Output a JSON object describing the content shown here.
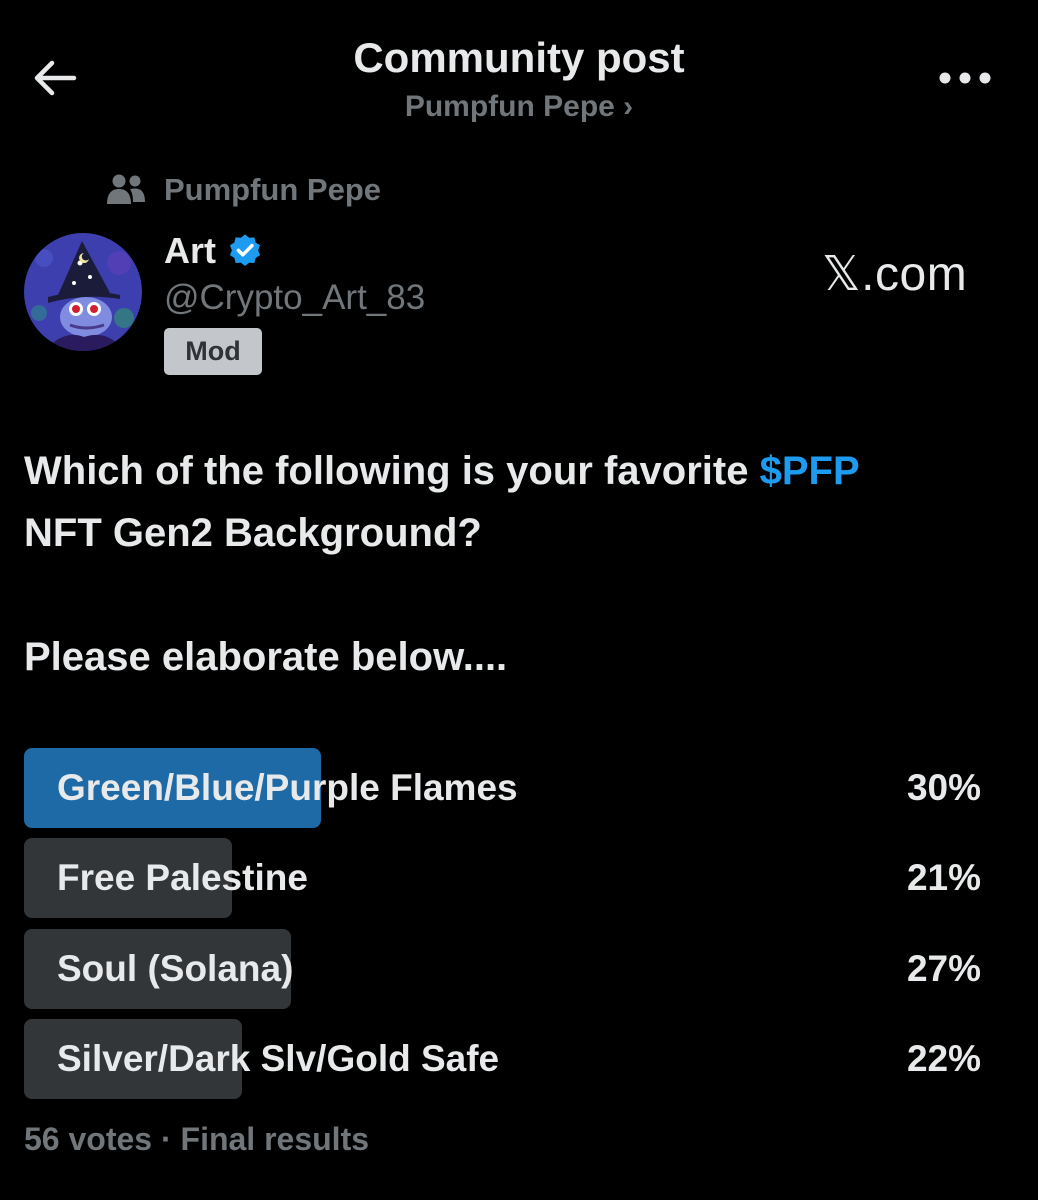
{
  "header": {
    "title": "Community post",
    "subtitle": "Pumpfun Pepe ›",
    "back_icon": "arrow-left-icon",
    "more_icon": "more-horizontal-icon"
  },
  "community": {
    "icon": "people-icon",
    "name": "Pumpfun Pepe"
  },
  "author": {
    "name": "Art",
    "verified_icon": "verified-badge-icon",
    "handle": "@Crypto_Art_83",
    "badge": "Mod"
  },
  "watermark": "𝕏.com",
  "post": {
    "line1_text": "Which of the following is your favorite ",
    "cashtag": "$PFP",
    "line2_text": "NFT Gen2 Background?",
    "line3_text": "Please elaborate below...."
  },
  "poll": {
    "options": [
      {
        "label": "Green/Blue/Purple Flames",
        "percent_text": "30%",
        "percent": 30,
        "winner": true
      },
      {
        "label": "Free Palestine",
        "percent_text": "21%",
        "percent": 21,
        "winner": false
      },
      {
        "label": "Soul (Solana)",
        "percent_text": "27%",
        "percent": 27,
        "winner": false
      },
      {
        "label": "Silver/Dark Slv/Gold Safe",
        "percent_text": "22%",
        "percent": 22,
        "winner": false
      }
    ],
    "footer": "56 votes · Final results"
  },
  "colors": {
    "background": "#000000",
    "text_primary": "#e7e9ea",
    "text_secondary": "#71767b",
    "accent": "#1d9bf0",
    "poll_winner": "#1d6aa7",
    "poll_bar": "#333639"
  }
}
